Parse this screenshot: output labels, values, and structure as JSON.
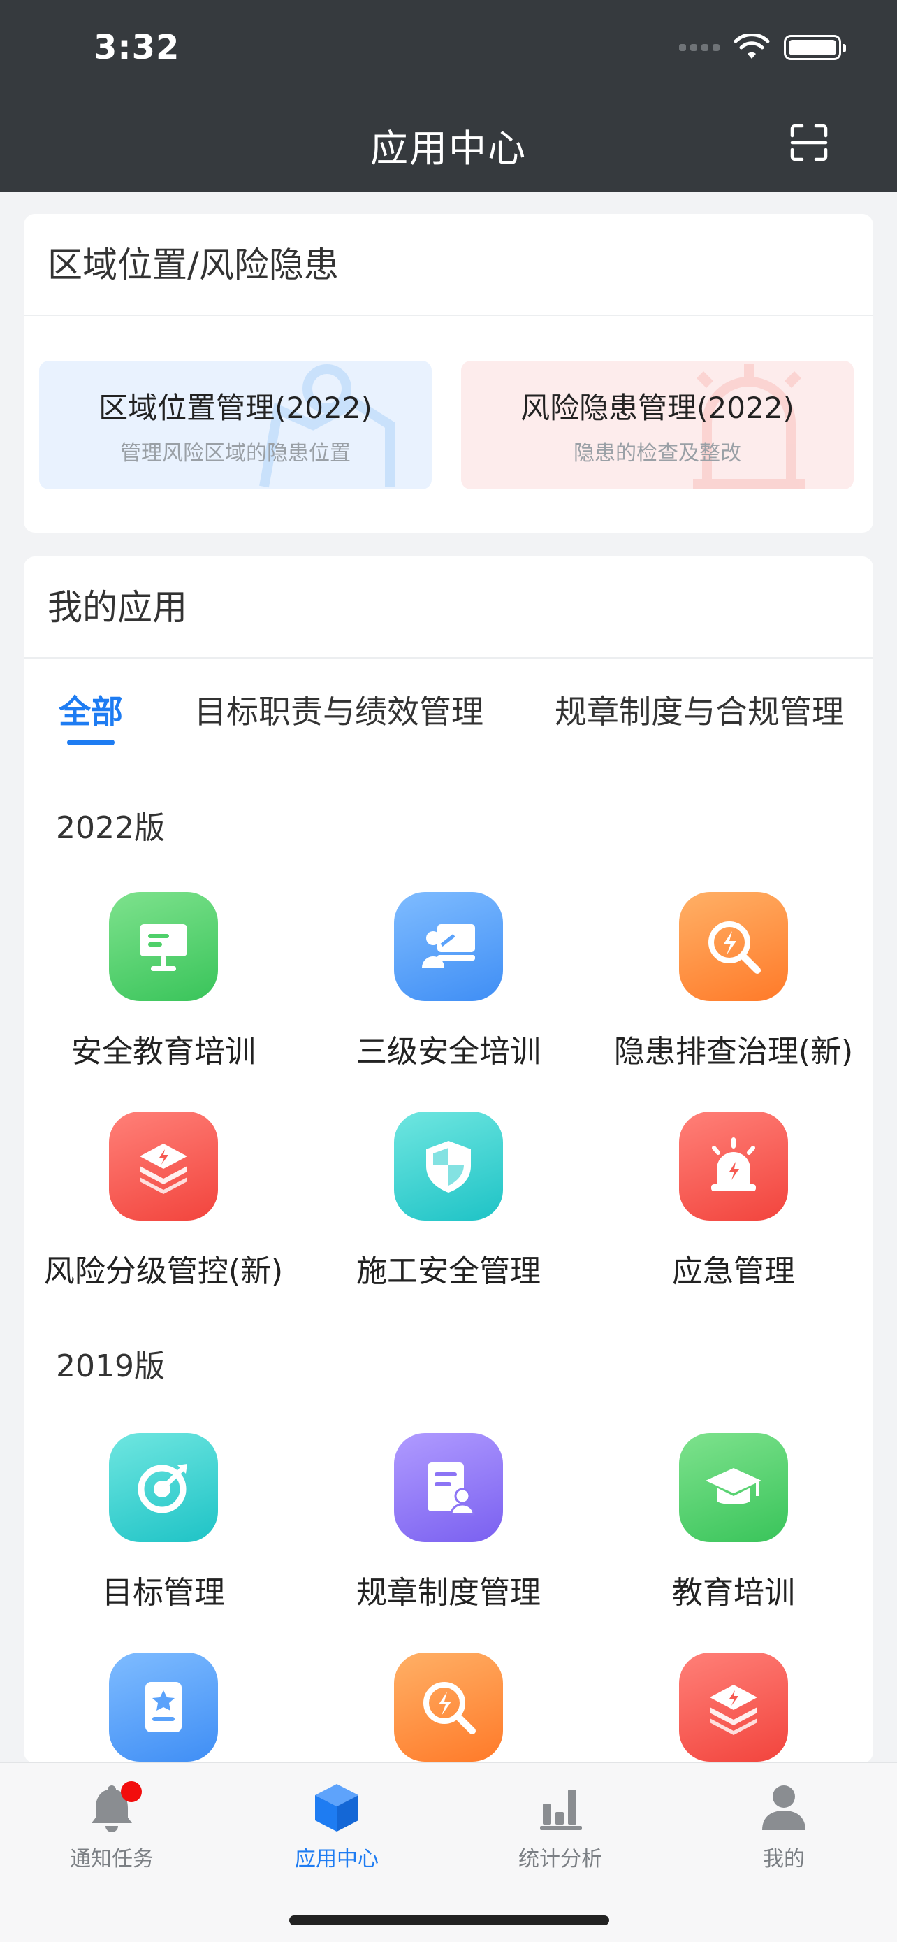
{
  "status_bar": {
    "time": "3:32"
  },
  "header": {
    "title": "应用中心"
  },
  "region_section": {
    "title": "区域位置/风险隐患",
    "tiles": [
      {
        "title": "区域位置管理(2022)",
        "subtitle": "管理风险区域的隐患位置"
      },
      {
        "title": "风险隐患管理(2022)",
        "subtitle": "隐患的检查及整改"
      }
    ]
  },
  "apps_section": {
    "title": "我的应用",
    "tabs": [
      {
        "label": "全部",
        "active": true
      },
      {
        "label": "目标职责与绩效管理",
        "active": false
      },
      {
        "label": "规章制度与合规管理",
        "active": false
      }
    ],
    "groups": [
      {
        "label": "2022版",
        "apps": [
          {
            "label": "安全教育培训",
            "icon": "presentation-board-icon",
            "color": "#4fd06a"
          },
          {
            "label": "三级安全培训",
            "icon": "teacher-board-icon",
            "color": "#5aa2fb"
          },
          {
            "label": "隐患排查治理(新)",
            "icon": "magnifier-bolt-icon",
            "color": "#ff8f3f"
          },
          {
            "label": "风险分级管控(新)",
            "icon": "layers-bolt-icon",
            "color": "#f65a52"
          },
          {
            "label": "施工安全管理",
            "icon": "shield-icon",
            "color": "#31cfce"
          },
          {
            "label": "应急管理",
            "icon": "alarm-light-icon",
            "color": "#f65a52"
          }
        ]
      },
      {
        "label": "2019版",
        "apps": [
          {
            "label": "目标管理",
            "icon": "target-icon",
            "color": "#31cfce"
          },
          {
            "label": "规章制度管理",
            "icon": "document-user-icon",
            "color": "#8c74f5"
          },
          {
            "label": "教育培训",
            "icon": "graduation-cap-icon",
            "color": "#4fd06a"
          },
          {
            "label": "",
            "icon": "badge-card-icon",
            "color": "#5aa2fb"
          },
          {
            "label": "",
            "icon": "magnifier-bolt-icon",
            "color": "#ff8f3f"
          },
          {
            "label": "",
            "icon": "layers-bolt-icon",
            "color": "#f65a52"
          }
        ]
      }
    ]
  },
  "tab_bar": {
    "items": [
      {
        "label": "通知任务",
        "icon": "bell-icon",
        "active": false,
        "has_badge": true
      },
      {
        "label": "应用中心",
        "icon": "cube-icon",
        "active": true
      },
      {
        "label": "统计分析",
        "icon": "bar-chart-icon",
        "active": false
      },
      {
        "label": "我的",
        "icon": "user-icon",
        "active": false
      }
    ]
  },
  "colors": {
    "accent": "#1e7cf2",
    "header_bg": "#363a3e",
    "badge": "#f20d0d"
  }
}
